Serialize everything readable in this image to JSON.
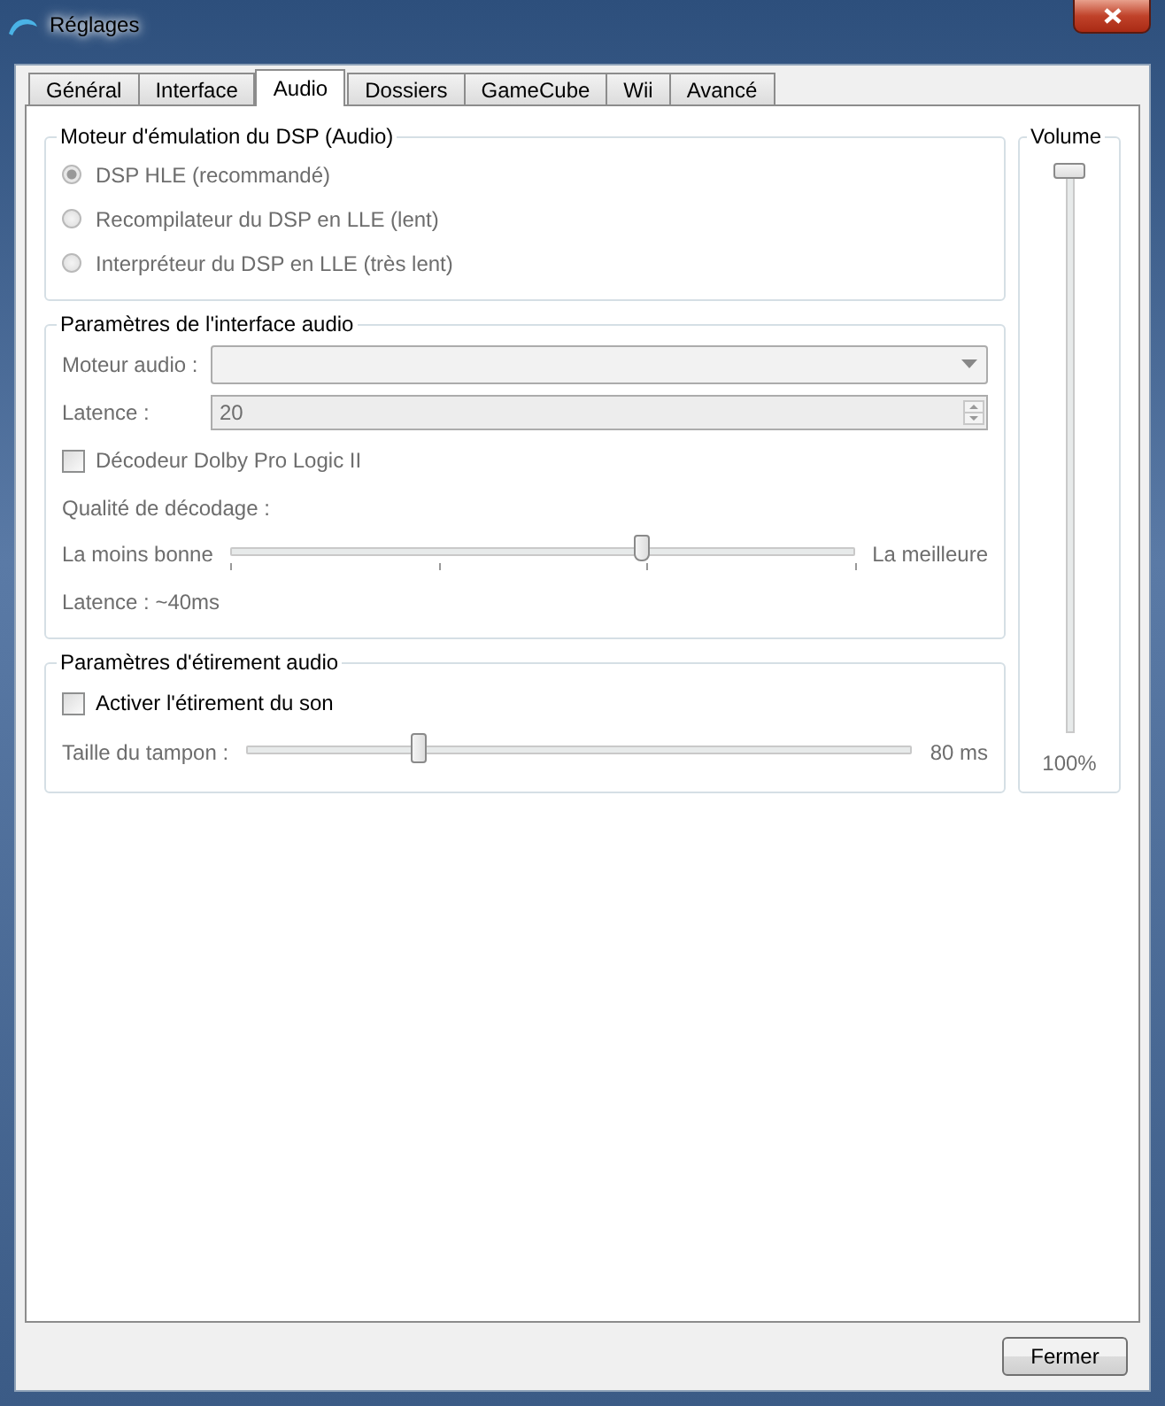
{
  "window": {
    "title": "Réglages"
  },
  "tabs": [
    {
      "label": "Général",
      "selected": false
    },
    {
      "label": "Interface",
      "selected": false
    },
    {
      "label": "Audio",
      "selected": true
    },
    {
      "label": "Dossiers",
      "selected": false
    },
    {
      "label": "GameCube",
      "selected": false
    },
    {
      "label": "Wii",
      "selected": false
    },
    {
      "label": "Avancé",
      "selected": false
    }
  ],
  "dsp_group": {
    "title": "Moteur d'émulation du DSP (Audio)",
    "disabled": true,
    "options": [
      {
        "label": "DSP HLE (recommandé)",
        "selected": true
      },
      {
        "label": "Recompilateur du DSP en LLE (lent)",
        "selected": false
      },
      {
        "label": "Interpréteur du DSP en LLE (très lent)",
        "selected": false
      }
    ]
  },
  "audio_interface": {
    "title": "Paramètres de l'interface audio",
    "disabled": true,
    "backend": {
      "label": "Moteur audio :"
    },
    "latency": {
      "label": "Latence :",
      "value": "20"
    },
    "dolby": {
      "label": "Décodeur Dolby Pro Logic II",
      "checked": false
    },
    "quality_label": "Qualité de décodage :",
    "quality": {
      "min_label": "La moins bonne",
      "max_label": "La meilleure",
      "level": 0.66
    },
    "latency_reading": "Latence : ~40ms"
  },
  "stretch_group": {
    "title": "Paramètres d'étirement audio",
    "enable": {
      "label": "Activer l'étirement du son",
      "checked": false
    },
    "buffer": {
      "label": "Taille du tampon :",
      "level": 0.26,
      "reading": "80 ms",
      "disabled": true
    }
  },
  "volume": {
    "title": "Volume",
    "level": 1,
    "reading": "100%"
  },
  "buttons": [
    "Fermer"
  ]
}
